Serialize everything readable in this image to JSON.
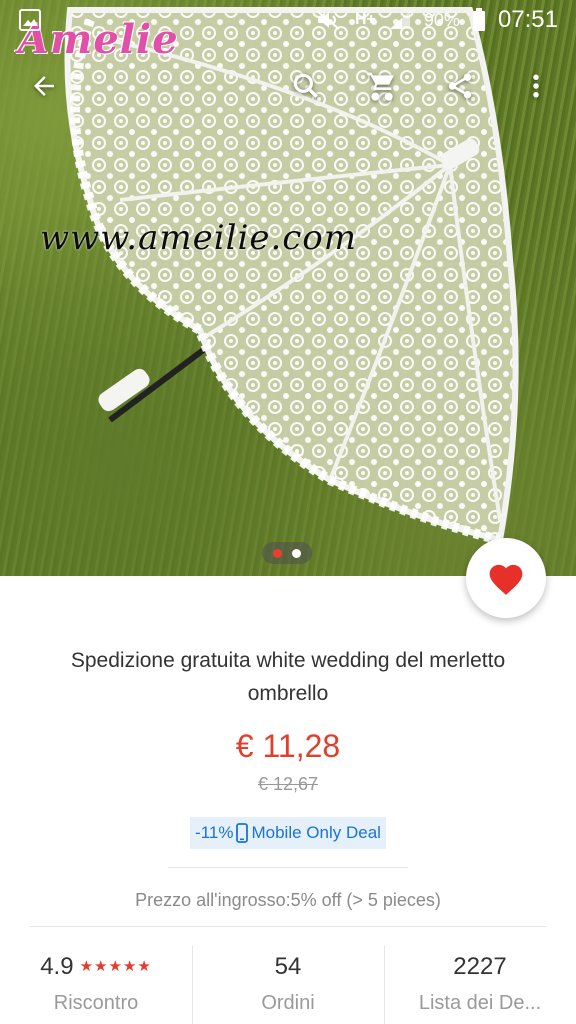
{
  "status_bar": {
    "battery": "90%",
    "time": "07:51",
    "network": "H+"
  },
  "hero": {
    "logo_text": "Amelie",
    "watermark_url": "www.ameilie.com",
    "carousel": {
      "total": 2,
      "active_index": 0
    }
  },
  "toolbar": {
    "icons": [
      "back-arrow-icon",
      "search-icon",
      "cart-icon",
      "share-icon",
      "more-vert-icon"
    ]
  },
  "product": {
    "title": "Spedizione gratuita white wedding del merletto ombrello",
    "price": "€ 11,28",
    "old_price": "€ 12,67",
    "deal": {
      "discount": "-11%",
      "label": "Mobile Only Deal"
    },
    "wholesale": "Prezzo all'ingrosso:5% off (> 5 pieces)"
  },
  "stats": {
    "rating": {
      "value": "4.9",
      "stars": "★★★★★",
      "label": "Riscontro"
    },
    "orders": {
      "value": "54",
      "label": "Ordini"
    },
    "wishlist": {
      "value": "2227",
      "label": "Lista dei De..."
    }
  },
  "colors": {
    "accent_red": "#e0402a",
    "deal_blue": "#1b73d6",
    "deal_bg": "#e6f0fb",
    "logo_pink": "#e24fa8"
  }
}
